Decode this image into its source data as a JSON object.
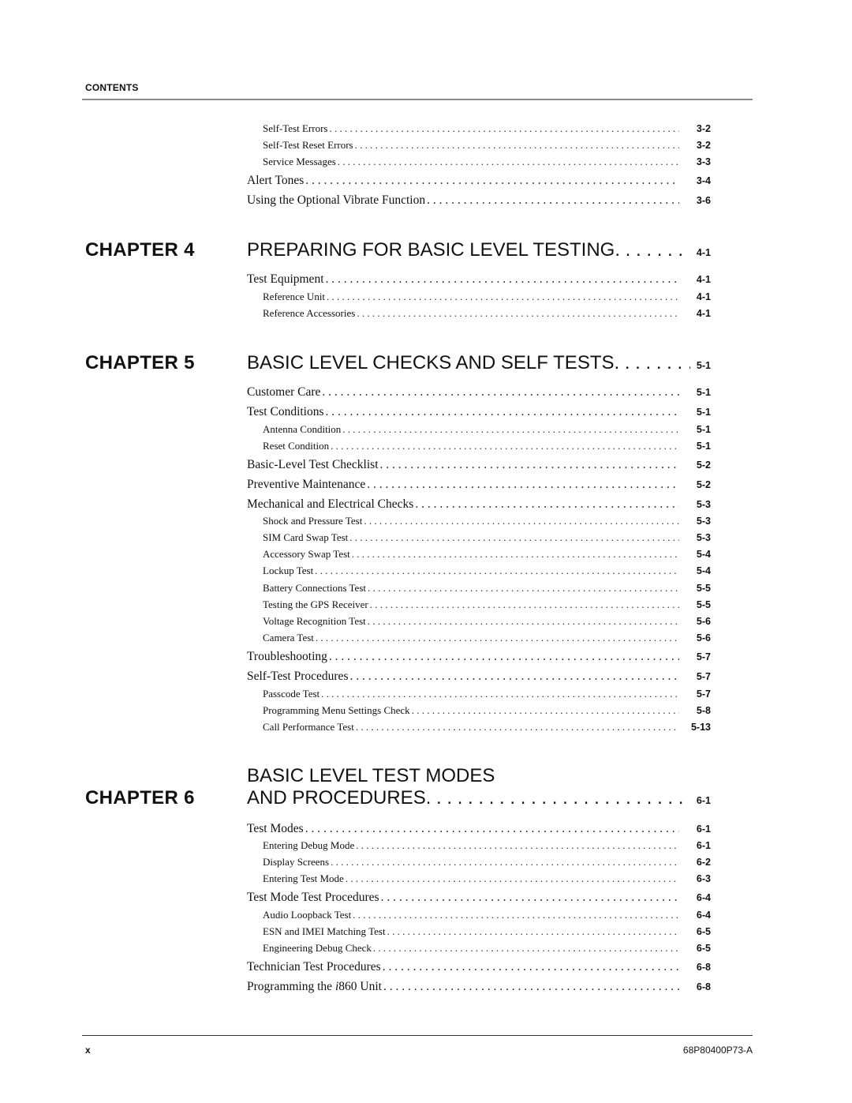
{
  "header": {
    "label": "CONTENTS"
  },
  "footer": {
    "page_number": "x",
    "document_id": "68P80400P73-A"
  },
  "continued_entries": [
    {
      "title": "Self-Test Errors",
      "page": "3-2",
      "level": 2
    },
    {
      "title": "Self-Test Reset Errors",
      "page": "3-2",
      "level": 2
    },
    {
      "title": "Service Messages",
      "page": "3-3",
      "level": 2
    },
    {
      "title": "Alert Tones",
      "page": "3-4",
      "level": 1
    },
    {
      "title": "Using the Optional Vibrate Function",
      "page": "3-6",
      "level": 1
    }
  ],
  "chapters": [
    {
      "label": "CHAPTER 4",
      "title": "PREPARING FOR BASIC LEVEL TESTING",
      "page": "4-1",
      "entries": [
        {
          "title": "Test Equipment",
          "page": "4-1",
          "level": 1
        },
        {
          "title": "Reference Unit",
          "page": "4-1",
          "level": 2
        },
        {
          "title": "Reference Accessories",
          "page": "4-1",
          "level": 2
        }
      ]
    },
    {
      "label": "CHAPTER 5",
      "title": "BASIC LEVEL CHECKS AND SELF TESTS",
      "page": "5-1",
      "entries": [
        {
          "title": "Customer Care",
          "page": "5-1",
          "level": 1
        },
        {
          "title": "Test Conditions",
          "page": "5-1",
          "level": 1
        },
        {
          "title": "Antenna Condition",
          "page": "5-1",
          "level": 2
        },
        {
          "title": "Reset Condition",
          "page": "5-1",
          "level": 2
        },
        {
          "title": "Basic-Level Test Checklist",
          "page": "5-2",
          "level": 1
        },
        {
          "title": "Preventive Maintenance",
          "page": "5-2",
          "level": 1
        },
        {
          "title": "Mechanical and Electrical Checks",
          "page": "5-3",
          "level": 1
        },
        {
          "title": "Shock and Pressure Test",
          "page": "5-3",
          "level": 2
        },
        {
          "title": "SIM Card Swap Test",
          "page": "5-3",
          "level": 2
        },
        {
          "title": "Accessory Swap Test",
          "page": "5-4",
          "level": 2
        },
        {
          "title": "Lockup Test",
          "page": "5-4",
          "level": 2
        },
        {
          "title": "Battery Connections Test",
          "page": "5-5",
          "level": 2
        },
        {
          "title": "Testing the GPS Receiver",
          "page": "5-5",
          "level": 2
        },
        {
          "title": "Voltage Recognition Test",
          "page": "5-6",
          "level": 2
        },
        {
          "title": "Camera Test",
          "page": "5-6",
          "level": 2
        },
        {
          "title": "Troubleshooting",
          "page": "5-7",
          "level": 1
        },
        {
          "title": "Self-Test Procedures",
          "page": "5-7",
          "level": 1
        },
        {
          "title": "Passcode Test",
          "page": "5-7",
          "level": 2
        },
        {
          "title": "Programming Menu Settings Check",
          "page": "5-8",
          "level": 2
        },
        {
          "title": "Call Performance Test",
          "page": "5-13",
          "level": 2
        }
      ]
    },
    {
      "label": "CHAPTER 6",
      "title_line1": "BASIC LEVEL TEST MODES",
      "title": "AND PROCEDURES",
      "page": "6-1",
      "entries": [
        {
          "title": "Test Modes",
          "page": "6-1",
          "level": 1
        },
        {
          "title": "Entering Debug Mode",
          "page": "6-1",
          "level": 2
        },
        {
          "title": "Display Screens",
          "page": "6-2",
          "level": 2
        },
        {
          "title": "Entering Test Mode",
          "page": "6-3",
          "level": 2
        },
        {
          "title": "Test Mode Test Procedures",
          "page": "6-4",
          "level": 1
        },
        {
          "title": "Audio Loopback Test",
          "page": "6-4",
          "level": 2
        },
        {
          "title": "ESN and IMEI Matching Test",
          "page": "6-5",
          "level": 2
        },
        {
          "title": "Engineering Debug Check",
          "page": "6-5",
          "level": 2
        },
        {
          "title": "Technician Test Procedures",
          "page": "6-8",
          "level": 1
        },
        {
          "title_prefix": "Programming the ",
          "title_italic": "i",
          "title_suffix": "860 Unit",
          "page": "6-8",
          "level": 1
        }
      ]
    }
  ]
}
